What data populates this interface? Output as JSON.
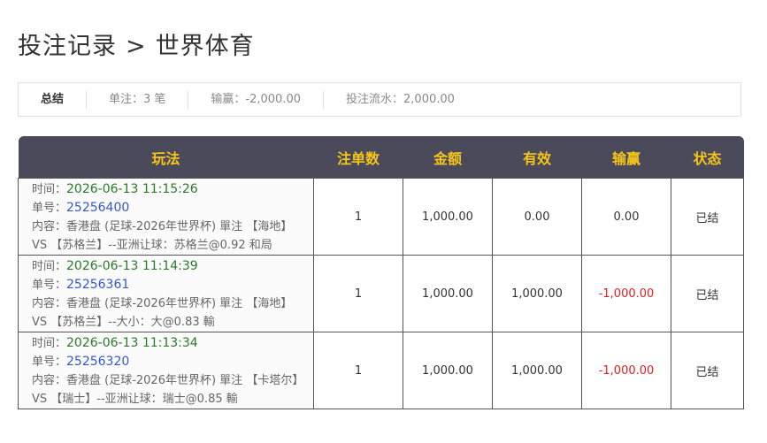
{
  "header": {
    "title": "投注记录",
    "separator": ">",
    "subtitle": "世界体育"
  },
  "summary": {
    "label": "总结",
    "count": "单注：3 笔",
    "winloss": "输赢：-2,000.00",
    "turnover": "投注流水：2,000.00"
  },
  "table": {
    "columns": [
      "玩法",
      "注单数",
      "金额",
      "有效",
      "输赢",
      "状态"
    ],
    "time_label": "时间：",
    "ticket_label": "单号：",
    "rows": [
      {
        "time": "2026-06-13 11:15:26",
        "ticket": "25256400",
        "content": "内容：香港盘 (足球-2026年世界杯) 單注 【海地】 VS 【苏格兰】--亚洲让球：苏格兰@0.92 和局",
        "count": "1",
        "amount": "1,000.00",
        "valid": "0.00",
        "winloss": "0.00",
        "status": "已结"
      },
      {
        "time": "2026-06-13 11:14:39",
        "ticket": "25256361",
        "content": "内容：香港盘 (足球-2026年世界杯) 單注 【海地】 VS 【苏格兰】--大小：大@0.83 輸",
        "count": "1",
        "amount": "1,000.00",
        "valid": "1,000.00",
        "winloss": "-1,000.00",
        "status": "已结"
      },
      {
        "time": "2026-06-13 11:13:34",
        "ticket": "25256320",
        "content": "内容：香港盘 (足球-2026年世界杯) 單注 【卡塔尔】 VS 【瑞士】--亚洲让球：瑞士@0.85 輸",
        "count": "1",
        "amount": "1,000.00",
        "valid": "1,000.00",
        "winloss": "-1,000.00",
        "status": "已结"
      }
    ]
  },
  "colors": {
    "header_bg": "#4b4a5a",
    "header_text": "#f5c518",
    "time": "#2a7a2a",
    "ticket": "#3557c8",
    "negative": "#e02020"
  }
}
